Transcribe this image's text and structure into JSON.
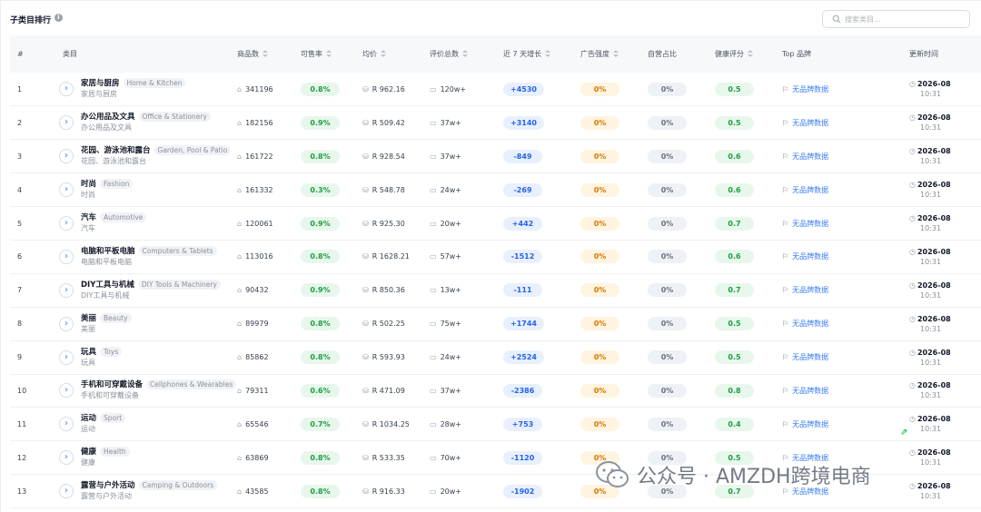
{
  "panel": {
    "title": "子类目排行"
  },
  "search": {
    "placeholder": "搜索类目..."
  },
  "headers": {
    "rank": "#",
    "category": "类目",
    "products": "商品数",
    "sell_rate": "可售率",
    "avg_price": "均价",
    "reviews": "评价总数",
    "growth": "近 7 天增长",
    "ad": "广告强度",
    "self_share": "自营占比",
    "health": "健康评分",
    "brand": "Top 品牌",
    "updated": "更新时间"
  },
  "rows": [
    {
      "rank": "1",
      "name": "家居与厨房",
      "en": "Home & Kitchen",
      "sub": "家居与厨房",
      "products": "341196",
      "sell_rate": "0.8%",
      "price": "R 962.16",
      "reviews": "120w+",
      "growth": "+4530",
      "ad": "0%",
      "self": "0%",
      "health": "0.5",
      "brand": "无品牌数据",
      "date": "2026-08",
      "time": "10:31"
    },
    {
      "rank": "2",
      "name": "办公用品及文具",
      "en": "Office & Stationery",
      "sub": "办公用品及文具",
      "products": "182156",
      "sell_rate": "0.9%",
      "price": "R 509.42",
      "reviews": "37w+",
      "growth": "+3140",
      "ad": "0%",
      "self": "0%",
      "health": "0.5",
      "brand": "无品牌数据",
      "date": "2026-08",
      "time": "10:31"
    },
    {
      "rank": "3",
      "name": "花园、游泳池和露台",
      "en": "Garden, Pool & Patio",
      "sub": "花园、游泳池和露台",
      "products": "161722",
      "sell_rate": "0.8%",
      "price": "R 928.54",
      "reviews": "37w+",
      "growth": "-849",
      "ad": "0%",
      "self": "0%",
      "health": "0.6",
      "brand": "无品牌数据",
      "date": "2026-08",
      "time": "10:31"
    },
    {
      "rank": "4",
      "name": "时尚",
      "en": "Fashion",
      "sub": "时尚",
      "products": "161332",
      "sell_rate": "0.3%",
      "price": "R 548.78",
      "reviews": "24w+",
      "growth": "-269",
      "ad": "0%",
      "self": "0%",
      "health": "0.6",
      "brand": "无品牌数据",
      "date": "2026-08",
      "time": "10:31"
    },
    {
      "rank": "5",
      "name": "汽车",
      "en": "Automotive",
      "sub": "汽车",
      "products": "120061",
      "sell_rate": "0.9%",
      "price": "R 925.30",
      "reviews": "20w+",
      "growth": "+442",
      "ad": "0%",
      "self": "0%",
      "health": "0.7",
      "brand": "无品牌数据",
      "date": "2026-08",
      "time": "10:31"
    },
    {
      "rank": "6",
      "name": "电脑和平板电脑",
      "en": "Computers & Tablets",
      "sub": "电脑和平板电脑",
      "products": "113016",
      "sell_rate": "0.8%",
      "price": "R 1628.21",
      "reviews": "57w+",
      "growth": "-1512",
      "ad": "0%",
      "self": "0%",
      "health": "0.6",
      "brand": "无品牌数据",
      "date": "2026-08",
      "time": "10:31"
    },
    {
      "rank": "7",
      "name": "DIY工具与机械",
      "en": "DIY Tools & Machinery",
      "sub": "DIY工具与机械",
      "products": "90432",
      "sell_rate": "0.9%",
      "price": "R 850.36",
      "reviews": "13w+",
      "growth": "-111",
      "ad": "0%",
      "self": "0%",
      "health": "0.7",
      "brand": "无品牌数据",
      "date": "2026-08",
      "time": "10:31"
    },
    {
      "rank": "8",
      "name": "美丽",
      "en": "Beauty",
      "sub": "美丽",
      "products": "89979",
      "sell_rate": "0.8%",
      "price": "R 502.25",
      "reviews": "75w+",
      "growth": "+1744",
      "ad": "0%",
      "self": "0%",
      "health": "0.5",
      "brand": "无品牌数据",
      "date": "2026-08",
      "time": "10:31"
    },
    {
      "rank": "9",
      "name": "玩具",
      "en": "Toys",
      "sub": "玩具",
      "products": "85862",
      "sell_rate": "0.8%",
      "price": "R 593.93",
      "reviews": "24w+",
      "growth": "+2524",
      "ad": "0%",
      "self": "0%",
      "health": "0.5",
      "brand": "无品牌数据",
      "date": "2026-08",
      "time": "10:31"
    },
    {
      "rank": "10",
      "name": "手机和可穿戴设备",
      "en": "Cellphones & Wearables",
      "sub": "手机和可穿戴设备",
      "products": "79311",
      "sell_rate": "0.6%",
      "price": "R 471.09",
      "reviews": "37w+",
      "growth": "-2386",
      "ad": "0%",
      "self": "0%",
      "health": "0.8",
      "brand": "无品牌数据",
      "date": "2026-08",
      "time": "10:31"
    },
    {
      "rank": "11",
      "name": "运动",
      "en": "Sport",
      "sub": "运动",
      "products": "65546",
      "sell_rate": "0.7%",
      "price": "R 1034.25",
      "reviews": "28w+",
      "growth": "+753",
      "ad": "0%",
      "self": "0%",
      "health": "0.4",
      "brand": "无品牌数据",
      "date": "2026-08",
      "time": "10:31"
    },
    {
      "rank": "12",
      "name": "健康",
      "en": "Health",
      "sub": "健康",
      "products": "63869",
      "sell_rate": "0.8%",
      "price": "R 533.35",
      "reviews": "70w+",
      "growth": "-1120",
      "ad": "0%",
      "self": "0%",
      "health": "0.5",
      "brand": "无品牌数据",
      "date": "2026-08",
      "time": "10:31"
    },
    {
      "rank": "13",
      "name": "露营与户外活动",
      "en": "Camping & Outdoors",
      "sub": "露营与户外活动",
      "products": "43585",
      "sell_rate": "0.8%",
      "price": "R 916.33",
      "reviews": "20w+",
      "growth": "-1902",
      "ad": "0%",
      "self": "0%",
      "health": "0.7",
      "brand": "无品牌数据",
      "date": "2026-08",
      "time": "10:31"
    }
  ],
  "watermark": {
    "text": "公众号 · AMZDH跨境电商"
  },
  "icons": {
    "info": "info-icon",
    "search": "search-icon",
    "expand": "chevron-right-icon",
    "products": "bag-icon",
    "price": "coin-icon",
    "reviews": "comment-icon",
    "brand": "bookmark-icon",
    "time": "clock-icon",
    "logo": "wechat-logo-icon"
  },
  "colors": {
    "green": "#1f9d45",
    "blue": "#2563eb",
    "orange": "#d97706",
    "link": "#3b7df0"
  }
}
